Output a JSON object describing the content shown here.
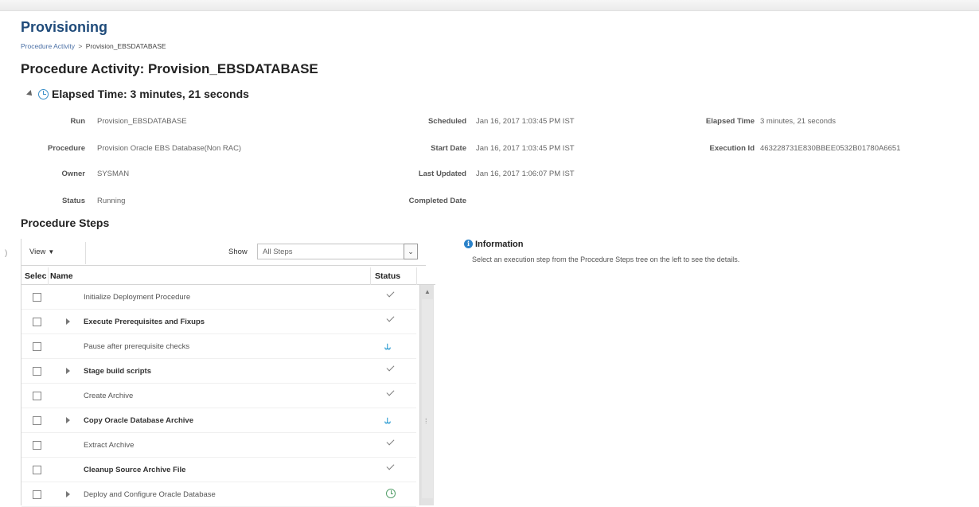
{
  "page": {
    "title": "Provisioning",
    "breadcrumb": {
      "link": "Procedure Activity",
      "separator": ">",
      "current": "Provision_EBSDATABASE"
    },
    "activity_title": "Procedure Activity: Provision_EBSDATABASE"
  },
  "elapsed": {
    "header": "Elapsed Time: 3 minutes, 21 seconds"
  },
  "details": {
    "run_label": "Run",
    "run_value": "Provision_EBSDATABASE",
    "procedure_label": "Procedure",
    "procedure_value": "Provision Oracle EBS Database(Non RAC)",
    "owner_label": "Owner",
    "owner_value": "SYSMAN",
    "status_label": "Status",
    "status_value": "Running",
    "scheduled_label": "Scheduled",
    "scheduled_value": "Jan 16, 2017 1:03:45 PM IST",
    "start_label": "Start Date",
    "start_value": "Jan 16, 2017 1:03:45 PM IST",
    "updated_label": "Last Updated",
    "updated_value": "Jan 16, 2017 1:06:07 PM IST",
    "completed_label": "Completed Date",
    "completed_value": "",
    "elapsed_label": "Elapsed Time",
    "elapsed_value": "3 minutes, 21 seconds",
    "execution_label": "Execution Id",
    "execution_value": "463228731E830BBEE0532B01780A6651"
  },
  "steps": {
    "section_title": "Procedure Steps",
    "view_label": "View",
    "show_label": "Show",
    "show_value": "All Steps",
    "col_select": "Selec",
    "col_name": "Name",
    "col_status": "Status",
    "rows": [
      {
        "name": "Initialize Deployment Procedure",
        "bold": false,
        "expandable": false,
        "status": "check-icon"
      },
      {
        "name": "Execute Prerequisites and Fixups",
        "bold": true,
        "expandable": true,
        "status": "check-icon"
      },
      {
        "name": "Pause after prerequisite checks",
        "bold": false,
        "expandable": false,
        "status": "running-icon"
      },
      {
        "name": "Stage build scripts",
        "bold": true,
        "expandable": true,
        "status": "check-icon"
      },
      {
        "name": "Create Archive",
        "bold": false,
        "expandable": false,
        "status": "check-icon"
      },
      {
        "name": "Copy Oracle Database Archive",
        "bold": true,
        "expandable": true,
        "status": "running-icon"
      },
      {
        "name": "Extract Archive",
        "bold": false,
        "expandable": false,
        "status": "check-icon"
      },
      {
        "name": "Cleanup Source Archive File",
        "bold": true,
        "expandable": false,
        "status": "check-icon"
      },
      {
        "name": "Deploy and Configure Oracle Database",
        "bold": false,
        "expandable": true,
        "status": "clock-icon"
      }
    ]
  },
  "information": {
    "title": "Information",
    "text": "Select an execution step from the Procedure Steps tree on the left to see the details."
  },
  "colors": {
    "title_blue": "#1f4b7a",
    "link_blue": "#4a6fa5",
    "info_blue": "#2a82c9",
    "running_blue": "#2a9bd1",
    "pending_green": "#55a06b"
  }
}
